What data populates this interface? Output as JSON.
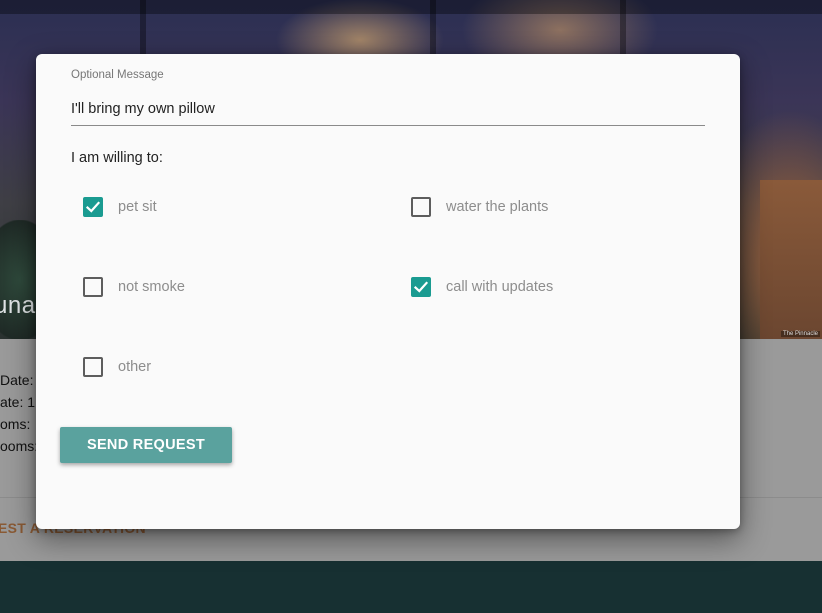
{
  "background": {
    "hero_title_fragment": "una",
    "photo_credit": "The Pinnacle",
    "details": [
      "Date: 1",
      "ate: 1",
      "oms:",
      "ooms:"
    ],
    "reserve_link": "EST A RESERVATION"
  },
  "form": {
    "message_label": "Optional Message",
    "message_value": "I'll bring my own pillow",
    "willing_label": "I am willing to:",
    "options": [
      {
        "label": "pet sit",
        "checked": true
      },
      {
        "label": "water the plants",
        "checked": false
      },
      {
        "label": "not smoke",
        "checked": false
      },
      {
        "label": "call with updates",
        "checked": true
      },
      {
        "label": "other",
        "checked": false
      }
    ],
    "submit_label": "SEND REQUEST"
  },
  "colors": {
    "checkbox_checked": "#1a9b91",
    "button": "#5aa29e",
    "footer": "#173032"
  }
}
